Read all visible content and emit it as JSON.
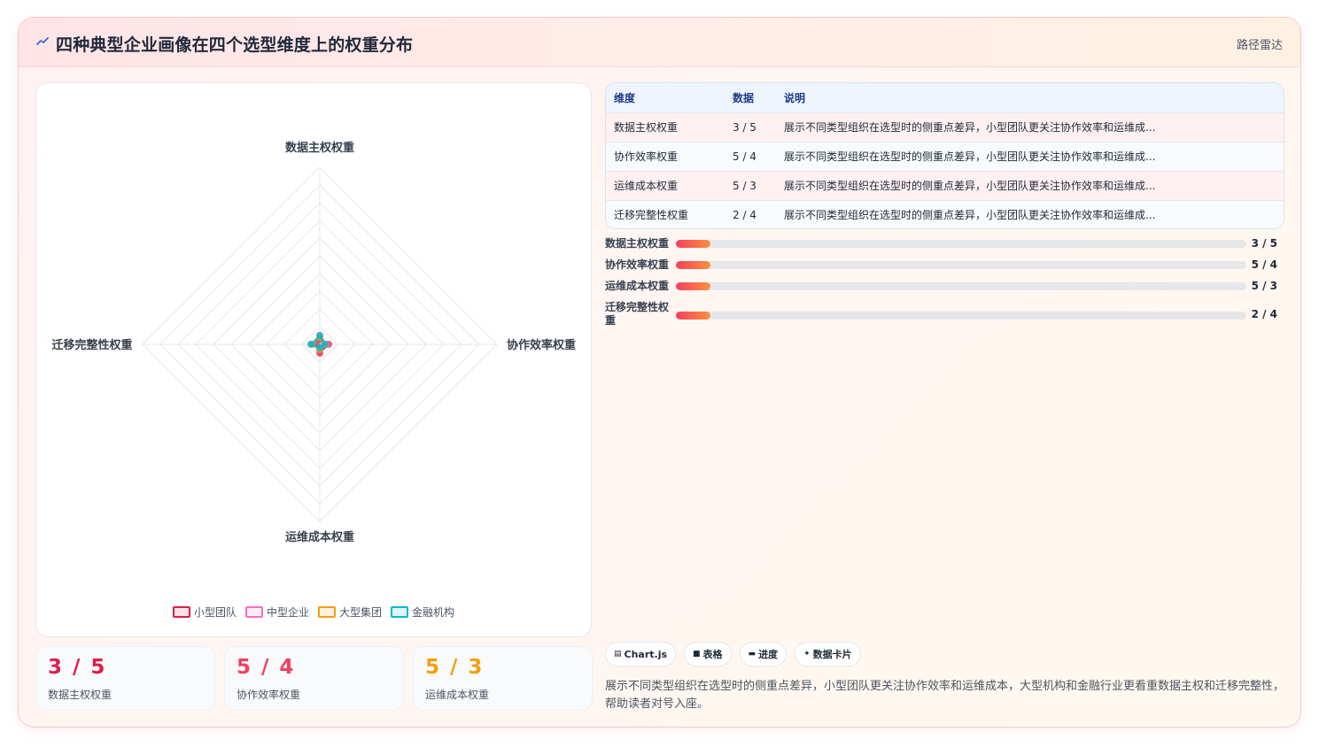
{
  "header": {
    "title": "四种典型企业画像在四个选型维度上的权重分布",
    "tag": "路径雷达",
    "icon": "trend-icon"
  },
  "chart_data": {
    "type": "radar",
    "axes": [
      "数据主权权重",
      "协作效率权重",
      "运维成本权重",
      "迁移完整性权重"
    ],
    "rlim": [
      0,
      100
    ],
    "grid": true,
    "legend_position": "bottom",
    "series": [
      {
        "name": "小型团队",
        "values": [
          3,
          5,
          5,
          2
        ],
        "color": "#e11d48"
      },
      {
        "name": "中型企业",
        "values": [
          5,
          4,
          3,
          4
        ],
        "color": "#f472b6"
      },
      {
        "name": "大型集团",
        "values": [
          4,
          3,
          3,
          5
        ],
        "color": "#f59e0b"
      },
      {
        "name": "金融机构",
        "values": [
          5,
          3,
          2,
          5
        ],
        "color": "#06b6d4"
      }
    ]
  },
  "kpis": [
    {
      "value": "3 / 5",
      "label": "数据主权权重",
      "color": "#e11d48"
    },
    {
      "value": "5 / 4",
      "label": "协作效率权重",
      "color": "#f43f5e"
    },
    {
      "value": "5 / 3",
      "label": "运维成本权重",
      "color": "#f59e0b"
    }
  ],
  "table": {
    "headers": [
      "维度",
      "数据",
      "说明"
    ],
    "rows": [
      [
        "数据主权权重",
        "3 / 5",
        "展示不同类型组织在选型时的侧重点差异，小型团队更关注协作效率和运维成..."
      ],
      [
        "协作效率权重",
        "5 / 4",
        "展示不同类型组织在选型时的侧重点差异，小型团队更关注协作效率和运维成..."
      ],
      [
        "运维成本权重",
        "5 / 3",
        "展示不同类型组织在选型时的侧重点差异，小型团队更关注协作效率和运维成..."
      ],
      [
        "迁移完整性权重",
        "2 / 4",
        "展示不同类型组织在选型时的侧重点差异，小型团队更关注协作效率和运维成..."
      ]
    ]
  },
  "bars": [
    {
      "label": "数据主权权重",
      "value": "3 / 5",
      "progress": 0.06
    },
    {
      "label": "协作效率权重",
      "value": "5 / 4",
      "progress": 0.06
    },
    {
      "label": "运维成本权重",
      "value": "5 / 3",
      "progress": 0.06
    },
    {
      "label": "迁移完整性权重",
      "value": "2 / 4",
      "progress": 0.06
    }
  ],
  "chips": [
    {
      "icon": "▤",
      "label": "Chart.js"
    },
    {
      "icon": "■",
      "label": "表格"
    },
    {
      "icon": "▬",
      "label": "进度"
    },
    {
      "icon": "✦",
      "label": "数据卡片"
    }
  ],
  "footnote": "展示不同类型组织在选型时的侧重点差异，小型团队更关注协作效率和运维成本，大型机构和金融行业更看重数据主权和迁移完整性，帮助读者对号入座。"
}
